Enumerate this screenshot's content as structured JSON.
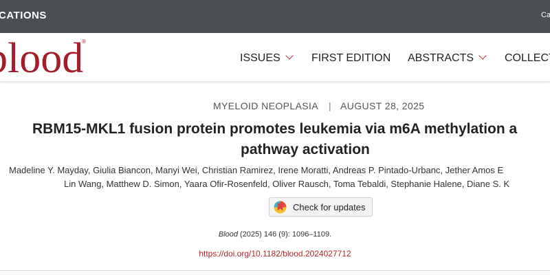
{
  "topbar": {
    "publisher": "CATIONS",
    "right_text": "Ca"
  },
  "header": {
    "logo_text": "blood",
    "logo_mark": "®",
    "nav": [
      {
        "label": "ISSUES",
        "dropdown": true
      },
      {
        "label": "FIRST EDITION",
        "dropdown": false
      },
      {
        "label": "ABSTRACTS",
        "dropdown": true
      },
      {
        "label": "COLLECT",
        "dropdown": false
      }
    ]
  },
  "article": {
    "category": "MYELOID NEOPLASIA",
    "separator": "|",
    "date": "AUGUST 28, 2025",
    "title_line1": "RBM15-MKL1 fusion protein promotes leukemia via m6A methylation a",
    "title_line2": "pathway activation",
    "authors_line1": "Madeline Y. Mayday, Giulia Biancon, Manyi Wei, Christian Ramirez, Irene Moratti, Andreas P. Pintado-Urbanc, Jether Amos E",
    "authors_line2": "Lin Wang, Matthew D. Simon, Yaara Ofir-Rosenfeld, Oliver Rausch, Toma Tebaldi, Stephanie Halene, Diane S. K",
    "check_updates_label": "Check for updates",
    "citation_journal": "Blood",
    "citation_rest": " (2025) 146 (9): 1096–1109.",
    "doi": "https://doi.org/10.1182/blood.2024027712"
  },
  "colors": {
    "brand": "#a31d2b",
    "topbar": "#4a4f54",
    "link": "#b3262e"
  }
}
